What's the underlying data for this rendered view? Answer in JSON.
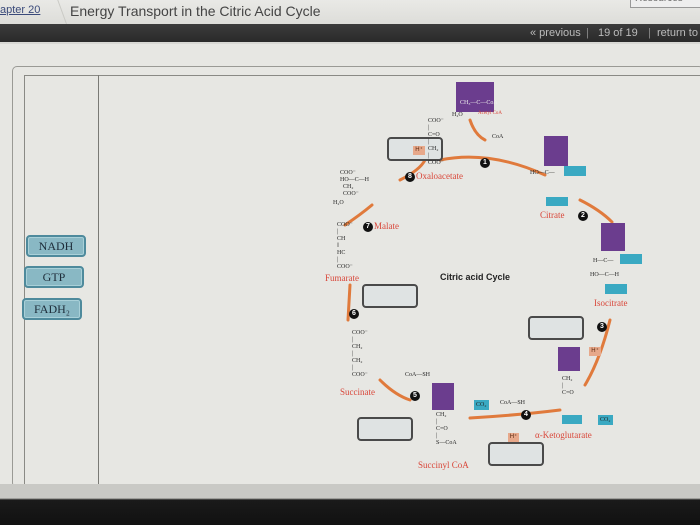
{
  "header": {
    "breadcrumb": "apter 20",
    "title": "Energy Transport in the Citric Acid Cycle",
    "resources_label": "Resources"
  },
  "nav": {
    "previous": "« previous",
    "page_indicator": "19 of 19",
    "return": "return to"
  },
  "answer_bank": [
    {
      "label": "NADH"
    },
    {
      "label": "GTP"
    },
    {
      "label": "FADH₂"
    }
  ],
  "diagram": {
    "title": "Citric acid Cycle",
    "molecules": {
      "acetyl_coa": {
        "name": "Acetyl CoA",
        "formula": "CH₃—C—CoA"
      },
      "oxaloacetate": {
        "name": "Oxaloacetate"
      },
      "citrate": {
        "name": "Citrate"
      },
      "isocitrate": {
        "name": "Isocitrate"
      },
      "alpha_ketoglutarate": {
        "name": "α-Ketoglutarate"
      },
      "succinyl_coa": {
        "name": "Succinyl CoA"
      },
      "succinate": {
        "name": "Succinate"
      },
      "fumarate": {
        "name": "Fumarate"
      },
      "malate": {
        "name": "Malate"
      }
    },
    "labels": {
      "h2o_top": "H₂O",
      "coa_top": "CoA",
      "h2o_malate": "H₂O",
      "h_plus": "H⁺",
      "co2": "CO₂",
      "coa_sh": "CoA—SH",
      "coo": "COO⁻",
      "ch2": "CH₂",
      "ho_c": "HO—C—",
      "c_o": "C=O",
      "s_coa": "S—CoA",
      "ch": "CH",
      "hc": "HC",
      "h_c": "H—C—",
      "ho_c_h": "HO—C—H"
    },
    "steps": [
      "1",
      "2",
      "3",
      "4",
      "5",
      "6",
      "7",
      "8"
    ]
  },
  "colors": {
    "accent_orange": "#e07a3c",
    "purple": "#6b3d8e",
    "teal": "#3aa9c2",
    "label_red": "#d9473a",
    "chip": "#89b8c4"
  }
}
